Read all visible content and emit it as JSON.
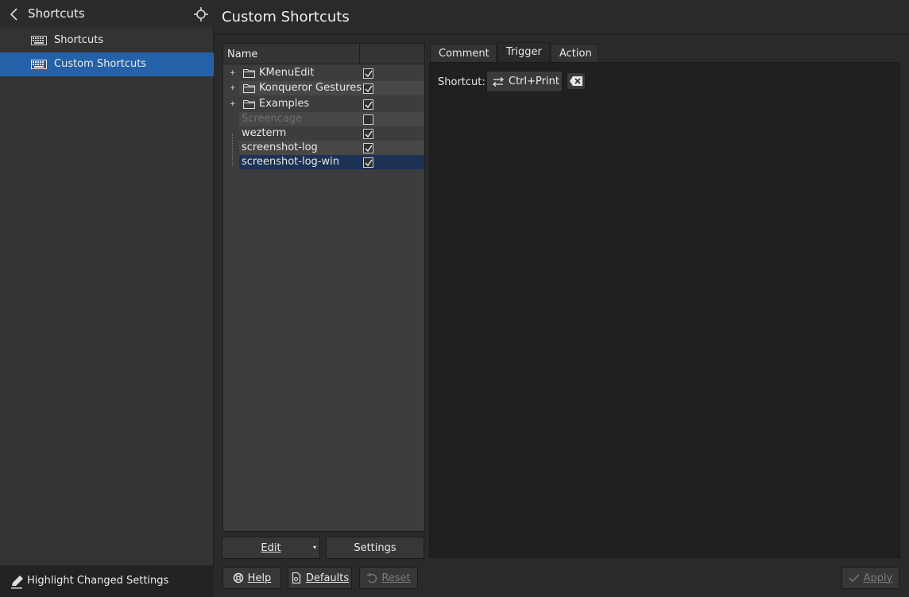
{
  "sidebar": {
    "title": "Shortcuts",
    "items": [
      {
        "label": "Shortcuts",
        "active": false
      },
      {
        "label": "Custom Shortcuts",
        "active": true
      }
    ],
    "footer_label": "Highlight Changed Settings"
  },
  "page": {
    "title": "Custom Shortcuts"
  },
  "tree": {
    "column_name": "Name",
    "rows": [
      {
        "name": "KMenuEdit",
        "group": true,
        "checked": true,
        "enabled": true
      },
      {
        "name": "Konqueror Gestures",
        "group": true,
        "checked": true,
        "enabled": true
      },
      {
        "name": "Examples",
        "group": true,
        "checked": true,
        "enabled": true
      },
      {
        "name": "Screencage",
        "group": false,
        "checked": false,
        "enabled": false
      },
      {
        "name": "wezterm",
        "group": false,
        "checked": true,
        "enabled": true
      },
      {
        "name": "screenshot-log",
        "group": false,
        "checked": true,
        "enabled": true
      },
      {
        "name": "screenshot-log-win",
        "group": false,
        "checked": true,
        "enabled": true,
        "selected": true
      }
    ],
    "edit_label": "Edit",
    "settings_label": "Settings"
  },
  "tabs": {
    "comment": "Comment",
    "trigger": "Trigger",
    "action": "Action",
    "active": "Trigger"
  },
  "trigger": {
    "shortcut_label": "Shortcut:",
    "shortcut_value": "Ctrl+Print"
  },
  "bottom": {
    "help": "Help",
    "defaults": "Defaults",
    "reset": "Reset",
    "apply": "Apply"
  },
  "colors": {
    "accent": "#2461a8",
    "selection": "#1d3356"
  }
}
